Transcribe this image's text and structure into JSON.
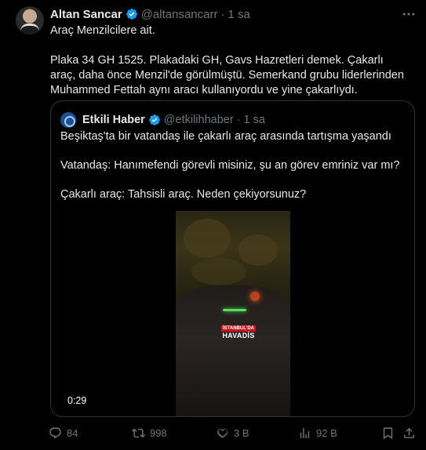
{
  "tweet": {
    "author_name": "Altan Sancar",
    "author_handle": "@altansancarr",
    "separator": "·",
    "time": "1 sa",
    "line1": "Araç Menzilcilere ait.",
    "line2": "Plaka 34 GH 1525. Plakadaki GH, Gavs Hazretleri demek. Çakarlı araç, daha önce Menzil'de görülmüştü.  Semerkand grubu liderlerinden Muhammed Fettah aynı aracı kullanıyordu ve yine çakarlıydı."
  },
  "quote": {
    "author_name": "Etkili Haber",
    "author_handle": "@etkilihhaber",
    "separator": "·",
    "time": "1 sa",
    "line1": "Beşiktaş'ta bir vatandaş ile çakarlı araç arasında tartışma yaşandı",
    "line2": "Vatandaş: Hanımefendi görevli misiniz, şu an görev emriniz var mı?",
    "line3": "Çakarlı araç: Tahsisli araç. Neden çekiyorsunuz?",
    "video": {
      "timecode": "0:29",
      "watermark_top": "İSTANBUL'DA",
      "watermark_bottom": "HAVADİS"
    }
  },
  "actions": {
    "replies": "84",
    "reposts": "998",
    "likes": "3 B",
    "views": "92 B"
  },
  "icons": {
    "verified": "verified-badge-icon",
    "more": "more-horizontal-icon",
    "reply": "reply-icon",
    "repost": "repost-icon",
    "like": "heart-icon",
    "views": "views-chart-icon",
    "bookmark": "bookmark-icon",
    "share": "share-icon"
  },
  "colors": {
    "background": "#000000",
    "text": "#e7e9ea",
    "muted": "#71767b",
    "border": "#2f3336",
    "verified": "#1d9bf0",
    "watermark_red": "#d3141f"
  }
}
